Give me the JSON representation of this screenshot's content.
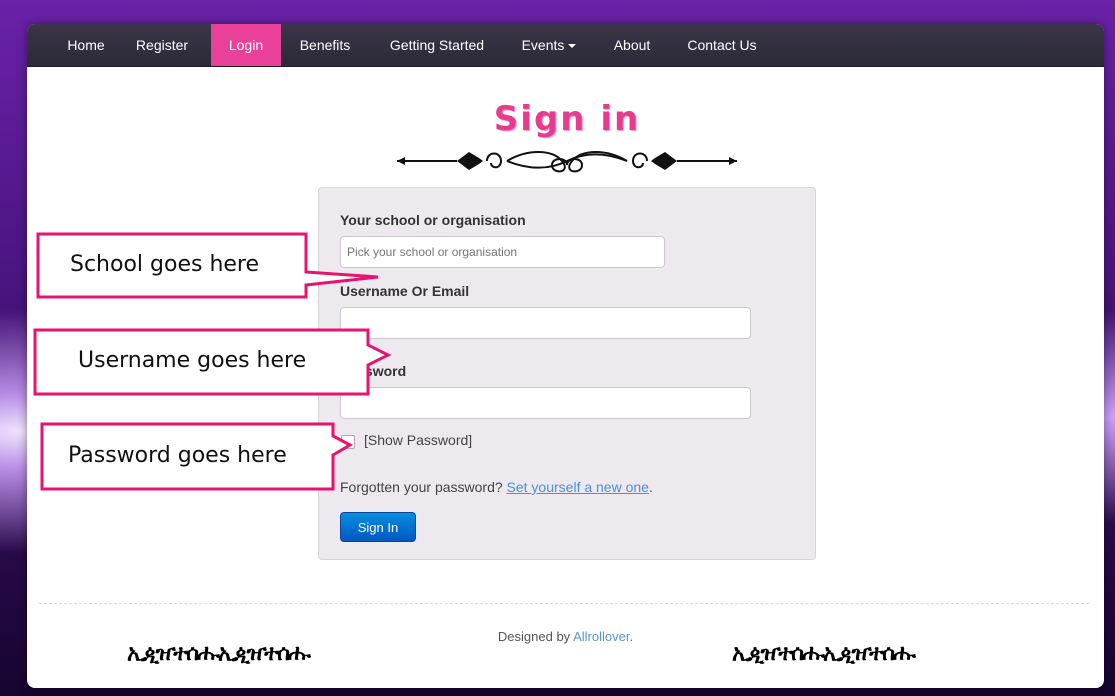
{
  "nav": {
    "items": [
      {
        "label": "Home"
      },
      {
        "label": "Register"
      },
      {
        "label": "Login"
      },
      {
        "label": "Benefits"
      },
      {
        "label": "Getting Started"
      },
      {
        "label": "Events"
      },
      {
        "label": "About"
      },
      {
        "label": "Contact Us"
      }
    ],
    "active": "Login",
    "active_color": "#e9409a"
  },
  "page": {
    "title": "Sign in"
  },
  "form": {
    "school_label": "Your school or organisation",
    "school_placeholder": "Pick your school or organisation",
    "username_label": "Username Or Email",
    "username_value": "",
    "password_label": "Password",
    "password_value": "",
    "show_password_label": "[Show Password]",
    "show_password_checked": false,
    "forgot_text": "Forgotten your password?",
    "forgot_link": "Set yourself a new one",
    "forgot_suffix": ".",
    "submit_label": "Sign In"
  },
  "footer": {
    "designed_by": "Designed by",
    "credit": "Allrollover",
    "credit_suffix": "."
  },
  "callouts": {
    "school": "School goes here",
    "username": "Username goes here",
    "password": "Password goes here",
    "border_color": "#e8136f"
  }
}
